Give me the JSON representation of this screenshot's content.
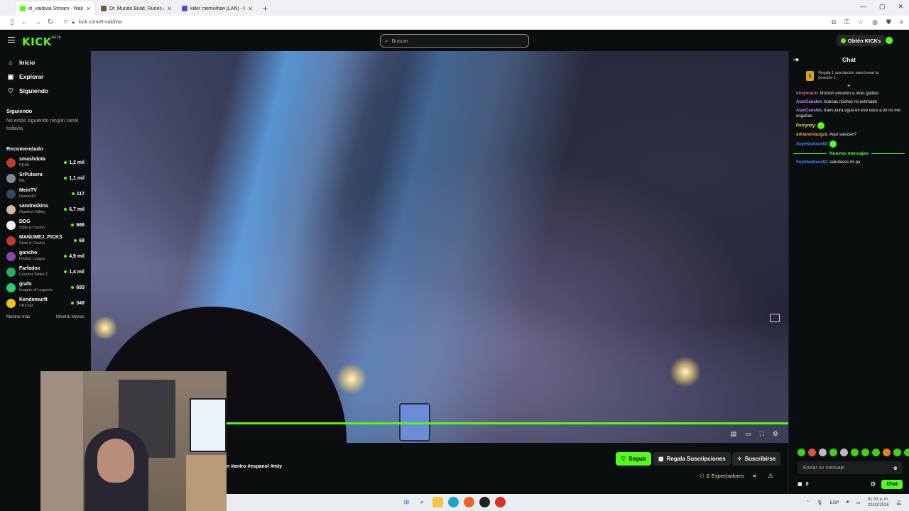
{
  "browser": {
    "tabs": [
      {
        "title": "el_valdivia Stream - Watch",
        "color": "#53fc18",
        "active": true
      },
      {
        "title": "Dr. Mundo Build, Runes & Cou",
        "color": "#6b5a3a",
        "active": false
      },
      {
        "title": "killer memo#lan [LAN] - Champ",
        "color": "#5b4bb5",
        "active": false
      }
    ],
    "new_tab": "+",
    "url": "kick.com/el-valdivia"
  },
  "header": {
    "logo": "KICK",
    "logo_tag": "BETA",
    "search_placeholder": "Buscar",
    "get_kicks": "Obtén KICKs"
  },
  "sidebar": {
    "nav": [
      {
        "label": "Inicio",
        "icon": "home-icon",
        "glyph": "⌂"
      },
      {
        "label": "Explorar",
        "icon": "compass-icon",
        "glyph": "▣"
      },
      {
        "label": "Siguiendo",
        "icon": "heart-icon",
        "glyph": "♡"
      }
    ],
    "following_title": "Siguiendo",
    "following_empty": "No estás siguiendo ningún canal todavía.",
    "recommended_title": "Recomendado",
    "recommended": [
      {
        "name": "smashdota",
        "category": "PEAK",
        "viewers": "1,2 mil",
        "color": "#c0392b"
      },
      {
        "name": "SrPulsera",
        "category": "IRL",
        "viewers": "1,1 mil",
        "color": "#7f8c8d"
      },
      {
        "name": "MeinTV",
        "category": "HumanitZ",
        "viewers": "117",
        "color": "#34495e"
      },
      {
        "name": "sandraskins",
        "category": "Stardew Valley",
        "viewers": "6,7 mil",
        "color": "#d5b8a5"
      },
      {
        "name": "DDG",
        "category": "Slots & Casino",
        "viewers": "668",
        "color": "#ecf0f1"
      },
      {
        "name": "MANUMEJ_PICKS",
        "category": "Slots & Casino",
        "viewers": "68",
        "color": "#c0392b"
      },
      {
        "name": "goncho",
        "category": "Rocket League",
        "viewers": "4,9 mil",
        "color": "#8e44ad"
      },
      {
        "name": "Farfadox",
        "category": "Counter-Strike 2",
        "viewers": "1,4 mil",
        "color": "#27ae60"
      },
      {
        "name": "grafo",
        "category": "League of Legends",
        "viewers": "693",
        "color": "#2ecc71"
      },
      {
        "name": "Kendomurft",
        "category": "VRChat",
        "viewers": "349",
        "color": "#f1c40f"
      }
    ],
    "show_more": "Mostrar más",
    "show_less": "Mostrar Menos"
  },
  "stream": {
    "tags": "n #antro #espanol #mty",
    "follow": "Seguir",
    "gift_subs": "Regala Suscripciones",
    "subscribe": "Suscribirse",
    "viewers_count": "2",
    "viewers_label": "Espectadores"
  },
  "chat": {
    "title": "Chat",
    "pinned": "Regala 1 suscripción para tomar la posición 1",
    "pinned_rank": "1",
    "messages": [
      {
        "user": "elreymario",
        "color": "#e26aa6",
        "text": ": broston encaren a unas gatitas"
      },
      {
        "user": "AlanCanales",
        "color": "#b88cf5",
        "text": ": buenas noches mi estimado"
      },
      {
        "user": "AlanCanales",
        "color": "#b88cf5",
        "text": ": traes pura agua en ese vaso a mi no me engañas"
      },
      {
        "user": "Porrymty",
        "color": "#ffd75a",
        "text": ":"
      },
      {
        "user": "adrianordazgza",
        "color": "#f2a65a",
        "text": ": Aqui saludan?"
      },
      {
        "user": "Soyelwallace82",
        "color": "#3f8cff",
        "text": ":"
      }
    ],
    "new_messages": "Nuevos mensajes",
    "after_messages": [
      {
        "user": "Soyelwallace82",
        "color": "#3f8cff",
        "text": ": saludosss mi pa"
      }
    ],
    "input_placeholder": "Enviar un mensaje",
    "points": "0",
    "send": "Chat"
  },
  "taskbar": {
    "lang": "ESP",
    "time": "01:33 a. m.",
    "date": "22/02/2026"
  }
}
